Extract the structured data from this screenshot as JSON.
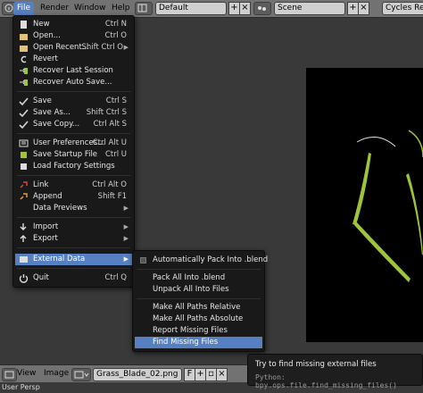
{
  "header": {
    "menus": [
      "File",
      "Render",
      "Window",
      "Help"
    ],
    "screen_layout": "Default",
    "scene": "Scene",
    "render_engine": "Cycles Render"
  },
  "file_menu": {
    "items": [
      {
        "label": "New",
        "shortcut": "Ctrl N",
        "icon": "new-file-icon"
      },
      {
        "label": "Open...",
        "shortcut": "Ctrl O",
        "icon": "open-folder-icon"
      },
      {
        "label": "Open Recent...",
        "shortcut": "Shift Ctrl O",
        "icon": "open-recent-icon",
        "submenu": true
      },
      {
        "label": "Revert",
        "shortcut": "",
        "icon": "revert-icon"
      },
      {
        "label": "Recover Last Session",
        "shortcut": "",
        "icon": "recover-icon"
      },
      {
        "label": "Recover Auto Save...",
        "shortcut": "",
        "icon": "recover-icon"
      },
      {
        "label": "Save",
        "shortcut": "Ctrl S",
        "icon": "checkmark-icon"
      },
      {
        "label": "Save As...",
        "shortcut": "Shift Ctrl S",
        "icon": "checkmark-icon"
      },
      {
        "label": "Save Copy...",
        "shortcut": "Ctrl Alt S",
        "icon": "checkmark-icon"
      },
      {
        "label": "User Preferences...",
        "shortcut": "Ctrl Alt U",
        "icon": "preferences-icon"
      },
      {
        "label": "Save Startup File",
        "shortcut": "Ctrl U",
        "icon": "save-startup-icon"
      },
      {
        "label": "Load Factory Settings",
        "shortcut": "",
        "icon": "factory-settings-icon"
      },
      {
        "label": "Link",
        "shortcut": "Ctrl Alt O",
        "icon": "link-icon"
      },
      {
        "label": "Append",
        "shortcut": "Shift F1",
        "icon": "append-icon"
      },
      {
        "label": "Data Previews",
        "shortcut": "",
        "icon": "",
        "submenu": true
      },
      {
        "label": "Import",
        "shortcut": "",
        "icon": "import-icon",
        "submenu": true
      },
      {
        "label": "Export",
        "shortcut": "",
        "icon": "export-icon",
        "submenu": true
      },
      {
        "label": "External Data",
        "shortcut": "",
        "icon": "external-data-icon",
        "submenu": true
      },
      {
        "label": "Quit",
        "shortcut": "Ctrl Q",
        "icon": "quit-icon"
      }
    ]
  },
  "external_data_menu": {
    "items": [
      {
        "label": "Automatically Pack Into .blend"
      },
      {
        "label": "Pack All Into .blend"
      },
      {
        "label": "Unpack All Into Files"
      },
      {
        "label": "Make All Paths Relative"
      },
      {
        "label": "Make All Paths Absolute"
      },
      {
        "label": "Report Missing Files"
      },
      {
        "label": "Find Missing Files"
      }
    ]
  },
  "tooltip": {
    "title": "Try to find missing external files",
    "python": "Python: bpy.ops.file.find_missing_files()"
  },
  "bottom_header": {
    "view": "View",
    "image": "Image",
    "image_name": "Grass_Blade_02.png"
  },
  "status": "User Persp",
  "colors": {
    "highlight": "#5680c2",
    "grass": "#9ec43a"
  }
}
